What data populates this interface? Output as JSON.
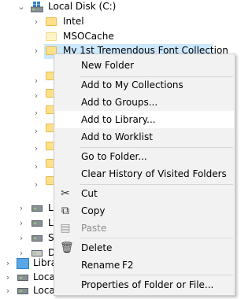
{
  "tree": {
    "local_disk_label": "Local Disk (C:)",
    "folders": [
      "Intel",
      "MSOCache",
      "My 1st Tremendous Font Collection"
    ],
    "partial_rows": [
      "L",
      "L",
      "S",
      "D"
    ],
    "libraries_label": "Libra",
    "local_disk_rows": [
      "Local",
      "Local"
    ]
  },
  "menu": {
    "new_folder": "New Folder",
    "add_collections": "Add to My Collections",
    "add_groups": "Add to Groups...",
    "add_library": "Add to Library...",
    "add_worklist": "Add to Worklist",
    "go_to_folder": "Go to Folder...",
    "clear_history": "Clear History of Visited Folders",
    "cut": "Cut",
    "copy": "Copy",
    "paste": "Paste",
    "delete": "Delete",
    "rename": "Rename",
    "rename_shortcut": "F2",
    "properties": "Properties of Folder or File..."
  }
}
